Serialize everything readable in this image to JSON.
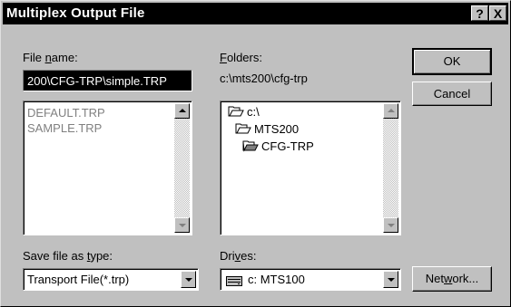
{
  "title": "Multiplex Output File",
  "title_buttons": {
    "help": "?",
    "close": "X"
  },
  "file_name": {
    "label_pre": "File ",
    "label_mn": "n",
    "label_post": "ame:",
    "value": "200\\CFG-TRP\\simple.TRP",
    "items": [
      "DEFAULT.TRP",
      "SAMPLE.TRP"
    ]
  },
  "folders": {
    "label_mn": "F",
    "label_post": "olders:",
    "path": "c:\\mts200\\cfg-trp",
    "tree": [
      {
        "label": "c:\\",
        "icon": "open-folder-icon"
      },
      {
        "label": "MTS200",
        "icon": "open-folder-icon"
      },
      {
        "label": "CFG-TRP",
        "icon": "open-folder-icon"
      }
    ]
  },
  "buttons": {
    "ok": "OK",
    "cancel": "Cancel",
    "network_pre": "Net",
    "network_mn": "w",
    "network_post": "ork..."
  },
  "save_type": {
    "label_pre": "Save file as ",
    "label_mn": "t",
    "label_post": "ype:",
    "value": "Transport File(*.trp)"
  },
  "drives": {
    "label_pre": "Dri",
    "label_mn": "v",
    "label_post": "es:",
    "value": "c: MTS100",
    "icon": "hard-drive-icon"
  },
  "colors": {
    "title_bg": "#000000",
    "dialog_bg": "#c0c0c0",
    "selection_bg": "#000000"
  }
}
